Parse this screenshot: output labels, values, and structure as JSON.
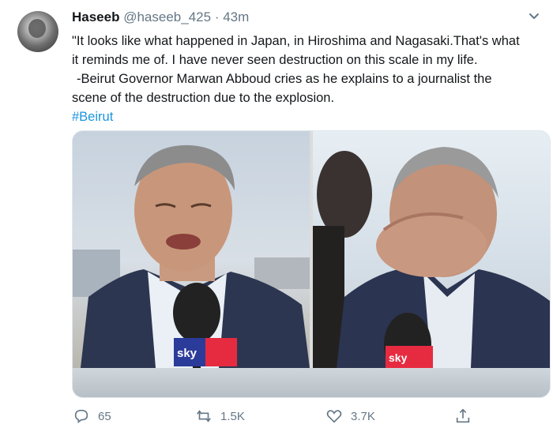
{
  "tweet": {
    "author_name": "Haseeb",
    "author_handle": "@haseeb_425",
    "separator": "·",
    "time": "43m",
    "text_lines": [
      "\"It looks like what happened in Japan, in Hiroshima and Nagasaki.That's what",
      "it reminds me of.  I have never seen destruction on this scale in my life.",
      " -Beirut Governor Marwan Abboud cries as he explains to a journalist the",
      "scene of the destruction due to the explosion."
    ],
    "hashtag": "#Beirut"
  },
  "media": {
    "left_mic_logo": "sky",
    "right_mic_logo": "sky"
  },
  "actions": {
    "reply_count": "65",
    "retweet_count": "1.5K",
    "like_count": "3.7K"
  },
  "icons": {
    "more": "chevron-down-icon",
    "reply": "reply-icon",
    "retweet": "retweet-icon",
    "like": "heart-icon",
    "share": "share-icon"
  },
  "colors": {
    "accent": "#1b95e0",
    "muted": "#657786",
    "text": "#14171a"
  }
}
